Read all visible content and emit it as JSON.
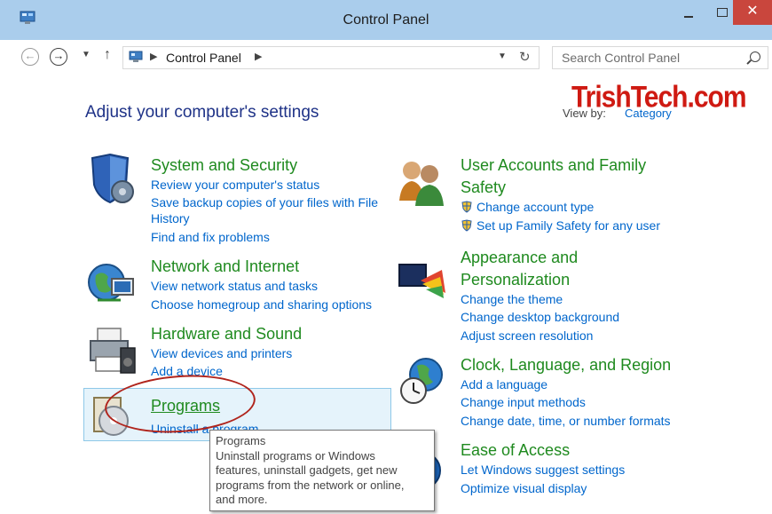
{
  "window": {
    "title": "Control Panel",
    "close_label": "✕"
  },
  "address_bar": {
    "path": "Control Panel"
  },
  "search": {
    "placeholder": "Search Control Panel"
  },
  "main": {
    "heading": "Adjust your computer's settings",
    "view_by_label": "View by:",
    "view_by_value": "Category"
  },
  "watermark": "TrishTech.com",
  "categories": {
    "system": {
      "title": "System and Security",
      "links": [
        "Review your computer's status",
        "Save backup copies of your files with File",
        "History",
        "Find and fix problems"
      ]
    },
    "network": {
      "title": "Network and Internet",
      "links": [
        "View network status and tasks",
        "Choose homegroup and sharing options"
      ]
    },
    "hardware": {
      "title": "Hardware and Sound",
      "links": [
        "View devices and printers",
        "Add a device"
      ]
    },
    "programs": {
      "title": "Programs",
      "links": [
        "Uninstall a program"
      ]
    },
    "accounts": {
      "title_line1": "User Accounts and Family",
      "title_line2": "Safety",
      "links": [
        "Change account type",
        "Set up Family Safety for any user"
      ]
    },
    "appearance": {
      "title_line1": "Appearance and",
      "title_line2": "Personalization",
      "links": [
        "Change the theme",
        "Change desktop background",
        "Adjust screen resolution"
      ]
    },
    "clock": {
      "title": "Clock, Language, and Region",
      "links": [
        "Add a language",
        "Change input methods",
        "Change date, time, or number formats"
      ]
    },
    "ease": {
      "title": "Ease of Access",
      "links": [
        "Let Windows suggest settings",
        "Optimize visual display"
      ]
    }
  },
  "tooltip": {
    "title": "Programs",
    "lines": [
      "Uninstall programs or Windows",
      "features, uninstall gadgets, get new",
      "programs from the network or online,",
      "and more."
    ]
  },
  "colors": {
    "titlebar": "#aacdec",
    "category_title": "#1f8a1f",
    "link": "#0066cc",
    "heading": "#1e3287",
    "close": "#c9463d",
    "highlight_circle": "#b0241c"
  }
}
